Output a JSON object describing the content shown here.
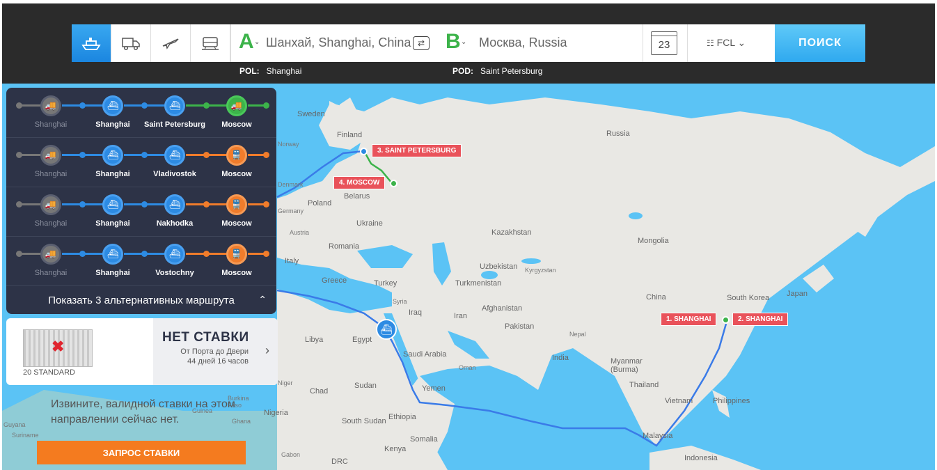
{
  "search": {
    "from_letter": "A",
    "to_letter": "B",
    "from_value": "Шанхай, Shanghai, China",
    "to_value": "Москва, Russia",
    "date_day": "23",
    "container_type": "FCL",
    "search_label": "ПОИСК",
    "pol_label": "POL:",
    "pol_value": "Shanghai",
    "pod_label": "POD:",
    "pod_value": "Saint Petersburg"
  },
  "transport_modes": [
    "ship-icon",
    "truck-icon",
    "plane-icon",
    "train-icon"
  ],
  "routes": [
    {
      "stops": [
        "Shanghai",
        "Shanghai",
        "Saint Petersburg",
        "Moscow"
      ],
      "last_mode": "truck",
      "last_color": "#3cb34a"
    },
    {
      "stops": [
        "Shanghai",
        "Shanghai",
        "Vladivostok",
        "Moscow"
      ],
      "last_mode": "train",
      "last_color": "#f07c2b"
    },
    {
      "stops": [
        "Shanghai",
        "Shanghai",
        "Nakhodka",
        "Moscow"
      ],
      "last_mode": "train",
      "last_color": "#f07c2b"
    },
    {
      "stops": [
        "Shanghai",
        "Shanghai",
        "Vostochny",
        "Moscow"
      ],
      "last_mode": "train",
      "last_color": "#f07c2b"
    }
  ],
  "alternatives_label": "Показать 3 альтернативных маршрута",
  "rate_card": {
    "container_type": "20 STANDARD",
    "status": "НЕТ СТАВКИ",
    "service": "От Порта до Двери",
    "duration": "44 дней 16 часов"
  },
  "sorry_text": "Извините, валидной ставки на этом направлении сейчас нет.",
  "request_button": "ЗАПРОС СТАВКИ",
  "map": {
    "tags": [
      "1. SHANGHAI",
      "2. SHANGHAI",
      "3. SAINT PETERSBURG",
      "4. MOSCOW"
    ],
    "labels": [
      "Sweden",
      "Finland",
      "Russia",
      "Poland",
      "Belarus",
      "Ukraine",
      "Romania",
      "Kazakhstan",
      "Mongolia",
      "Uzbekistan",
      "Kyrgyzstan",
      "Turkmenistan",
      "Greece",
      "Turkey",
      "Syria",
      "Iraq",
      "Iran",
      "Afghanistan",
      "Pakistan",
      "Nepal",
      "China",
      "South Korea",
      "Japan",
      "Libya",
      "Egypt",
      "Saudi Arabia",
      "Oman",
      "India",
      "Myanmar (Burma)",
      "Thailand",
      "Vietnam",
      "Philippines",
      "Chad",
      "Sudan",
      "Yemen",
      "Ethiopia",
      "South Sudan",
      "Somalia",
      "Kenya",
      "Nigeria",
      "Malaysia",
      "Indonesia",
      "DRC",
      "Italy",
      "Austria",
      "Germany",
      "Denmark",
      "Norway",
      "Niger",
      "Burkina Faso",
      "Ghana",
      "Guinea",
      "Guyana",
      "Suriname",
      "Gabon"
    ],
    "colors": {
      "water": "#5bc3f5",
      "land": "#e9e8e4",
      "route": "#3a7be8",
      "truck": "#3cb34a",
      "tag": "#e9525a"
    }
  }
}
